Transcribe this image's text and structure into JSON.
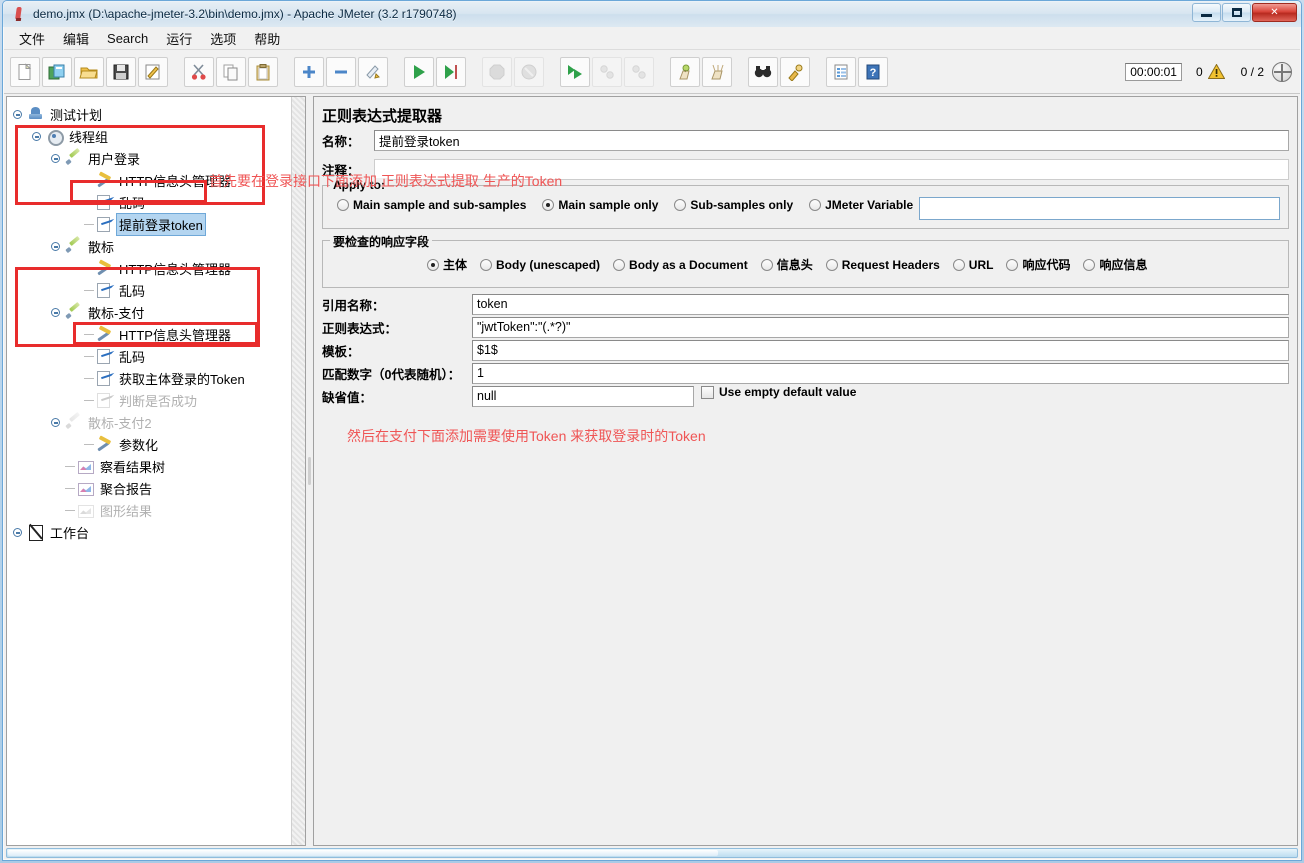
{
  "window": {
    "title": "demo.jmx (D:\\apache-jmeter-3.2\\bin\\demo.jmx) - Apache JMeter (3.2 r1790748)",
    "minimize_label": "",
    "maximize_label": "",
    "close_label": "✕"
  },
  "menubar": {
    "items": [
      {
        "label": "文件",
        "name": "menu-file"
      },
      {
        "label": "编辑",
        "name": "menu-edit"
      },
      {
        "label": "Search",
        "name": "menu-search"
      },
      {
        "label": "运行",
        "name": "menu-run"
      },
      {
        "label": "选项",
        "name": "menu-options"
      },
      {
        "label": "帮助",
        "name": "menu-help"
      }
    ]
  },
  "toolbar": {
    "buttons": [
      {
        "name": "new-icon",
        "title": "新建",
        "disabled": false
      },
      {
        "name": "templates-icon",
        "title": "模板",
        "disabled": false
      },
      {
        "name": "open-icon",
        "title": "打开",
        "disabled": false
      },
      {
        "name": "save-icon",
        "title": "保存",
        "disabled": false
      },
      {
        "name": "save-as-icon",
        "title": "另存为",
        "disabled": false
      },
      {
        "name": "cut-icon",
        "title": "剪切",
        "disabled": false
      },
      {
        "name": "copy-icon",
        "title": "复制",
        "disabled": false
      },
      {
        "name": "paste-icon",
        "title": "粘贴",
        "disabled": false
      },
      {
        "name": "expand-all-icon",
        "title": "展开全部",
        "disabled": false
      },
      {
        "name": "collapse-all-icon",
        "title": "收起全部",
        "disabled": false
      },
      {
        "name": "toggle-icon",
        "title": "切换",
        "disabled": false
      },
      {
        "name": "start-icon",
        "title": "启动",
        "disabled": false
      },
      {
        "name": "start-no-pause-icon",
        "title": "无暂停启动",
        "disabled": false
      },
      {
        "name": "stop-icon",
        "title": "停止",
        "disabled": true
      },
      {
        "name": "shutdown-icon",
        "title": "关闭",
        "disabled": true
      },
      {
        "name": "remote-start-all-icon",
        "title": "远程全部启动",
        "disabled": false
      },
      {
        "name": "remote-stop-all-icon",
        "title": "远程全部停止",
        "disabled": true
      },
      {
        "name": "remote-shutdown-all-icon",
        "title": "远程全部关闭",
        "disabled": true
      },
      {
        "name": "clear-icon",
        "title": "清除",
        "disabled": false
      },
      {
        "name": "clear-all-icon",
        "title": "清除全部",
        "disabled": false
      },
      {
        "name": "search-icon",
        "title": "查找",
        "disabled": false
      },
      {
        "name": "reset-search-icon",
        "title": "重置查找",
        "disabled": false
      },
      {
        "name": "function-helper-icon",
        "title": "函数助手对话框",
        "disabled": false
      },
      {
        "name": "help-icon",
        "title": "帮助",
        "disabled": false
      }
    ],
    "status": {
      "elapsed_time": "00:00:01",
      "warning_count": "0",
      "thread_count": "0 / 2"
    }
  },
  "tree": {
    "nodes": [
      {
        "label": "测试计划",
        "indent": 0,
        "icon": "test-plan-icon",
        "handle": true,
        "tick": false,
        "selected": false,
        "disabled": false,
        "name": "tree-node-test-plan"
      },
      {
        "label": "线程组",
        "indent": 1,
        "icon": "thread-group-icon",
        "handle": true,
        "tick": false,
        "selected": false,
        "disabled": false,
        "name": "tree-node-thread-group"
      },
      {
        "label": "用户登录",
        "indent": 2,
        "icon": "sampler-icon",
        "handle": true,
        "tick": false,
        "selected": false,
        "disabled": false,
        "name": "tree-node-user-login"
      },
      {
        "label": "HTTP信息头管理器",
        "indent": 3,
        "icon": "header-manager-icon",
        "handle": false,
        "tick": true,
        "selected": false,
        "disabled": false,
        "name": "tree-node-header-manager-1"
      },
      {
        "label": "乱码",
        "indent": 3,
        "icon": "regex-extractor-icon",
        "handle": false,
        "tick": true,
        "selected": false,
        "disabled": false,
        "name": "tree-node-luanma-1"
      },
      {
        "label": "提前登录token",
        "indent": 3,
        "icon": "regex-extractor-icon",
        "handle": false,
        "tick": true,
        "selected": true,
        "disabled": false,
        "name": "tree-node-login-token"
      },
      {
        "label": "散标",
        "indent": 2,
        "icon": "sampler-icon",
        "handle": true,
        "tick": false,
        "selected": false,
        "disabled": false,
        "name": "tree-node-sanbiao"
      },
      {
        "label": "HTTP信息头管理器",
        "indent": 3,
        "icon": "header-manager-icon",
        "handle": false,
        "tick": true,
        "selected": false,
        "disabled": false,
        "name": "tree-node-header-manager-2"
      },
      {
        "label": "乱码",
        "indent": 3,
        "icon": "regex-extractor-icon",
        "handle": false,
        "tick": true,
        "selected": false,
        "disabled": false,
        "name": "tree-node-luanma-2"
      },
      {
        "label": "散标-支付",
        "indent": 2,
        "icon": "sampler-icon",
        "handle": true,
        "tick": false,
        "selected": false,
        "disabled": false,
        "name": "tree-node-sanbiao-pay"
      },
      {
        "label": "HTTP信息头管理器",
        "indent": 3,
        "icon": "header-manager-icon",
        "handle": false,
        "tick": true,
        "selected": false,
        "disabled": false,
        "name": "tree-node-header-manager-3"
      },
      {
        "label": "乱码",
        "indent": 3,
        "icon": "regex-extractor-icon",
        "handle": false,
        "tick": true,
        "selected": false,
        "disabled": false,
        "name": "tree-node-luanma-3"
      },
      {
        "label": "获取主体登录的Token",
        "indent": 3,
        "icon": "regex-extractor-icon",
        "handle": false,
        "tick": true,
        "selected": false,
        "disabled": false,
        "name": "tree-node-get-token"
      },
      {
        "label": "判断是否成功",
        "indent": 3,
        "icon": "assertion-icon",
        "handle": false,
        "tick": true,
        "selected": false,
        "disabled": true,
        "name": "tree-node-assertion"
      },
      {
        "label": "散标-支付2",
        "indent": 2,
        "icon": "sampler-icon",
        "handle": true,
        "tick": false,
        "selected": false,
        "disabled": true,
        "name": "tree-node-sanbiao-pay2"
      },
      {
        "label": "参数化",
        "indent": 3,
        "icon": "header-manager-icon",
        "handle": false,
        "tick": true,
        "selected": false,
        "disabled": false,
        "name": "tree-node-params"
      },
      {
        "label": "察看结果树",
        "indent": 2,
        "icon": "listener-icon",
        "handle": false,
        "tick": true,
        "selected": false,
        "disabled": false,
        "name": "tree-node-view-results-tree"
      },
      {
        "label": "聚合报告",
        "indent": 2,
        "icon": "listener-icon",
        "handle": false,
        "tick": true,
        "selected": false,
        "disabled": false,
        "name": "tree-node-aggregate-report"
      },
      {
        "label": "图形结果",
        "indent": 2,
        "icon": "listener-icon",
        "handle": false,
        "tick": true,
        "selected": false,
        "disabled": true,
        "name": "tree-node-graph-results"
      },
      {
        "label": "工作台",
        "indent": 0,
        "icon": "workbench-icon",
        "handle": true,
        "tick": false,
        "selected": false,
        "disabled": false,
        "name": "tree-node-workbench"
      }
    ]
  },
  "annotations": [
    {
      "text": "首先要在登录接口下面添加 正则表达式提取 生产的Token",
      "name": "annotation-login-token"
    },
    {
      "text": "然后在支付下面添加需要使用Token 来获取登录时的Token",
      "name": "annotation-pay-token"
    }
  ],
  "panel": {
    "title": "正则表达式提取器",
    "name_label": "名称：",
    "name_value": "提前登录token",
    "comment_label": "注释：",
    "comment_value": "",
    "apply_to": {
      "legend": "Apply to:",
      "options": [
        {
          "label": "Main sample and sub-samples",
          "selected": false,
          "name": "radio-main-and-sub"
        },
        {
          "label": "Main sample only",
          "selected": true,
          "name": "radio-main-only"
        },
        {
          "label": "Sub-samples only",
          "selected": false,
          "name": "radio-sub-only"
        },
        {
          "label": "JMeter Variable",
          "selected": false,
          "name": "radio-jmeter-variable"
        }
      ],
      "variable_value": ""
    },
    "response_field": {
      "legend": "要检查的响应字段",
      "options": [
        {
          "label": "主体",
          "selected": true,
          "name": "radio-body"
        },
        {
          "label": "Body (unescaped)",
          "selected": false,
          "name": "radio-body-unescaped"
        },
        {
          "label": "Body as a Document",
          "selected": false,
          "name": "radio-body-as-document"
        },
        {
          "label": "信息头",
          "selected": false,
          "name": "radio-headers"
        },
        {
          "label": "Request Headers",
          "selected": false,
          "name": "radio-request-headers"
        },
        {
          "label": "URL",
          "selected": false,
          "name": "radio-url"
        },
        {
          "label": "响应代码",
          "selected": false,
          "name": "radio-response-code"
        },
        {
          "label": "响应信息",
          "selected": false,
          "name": "radio-response-message"
        }
      ]
    },
    "fields": [
      {
        "label": "引用名称：",
        "value": "token",
        "name": "reference-name"
      },
      {
        "label": "正则表达式：",
        "value": "\"jwtToken\":\"(.*?)\"",
        "name": "regular-expression"
      },
      {
        "label": "模板：",
        "value": "$1$",
        "name": "template"
      },
      {
        "label": "匹配数字（0代表随机）：",
        "value": "1",
        "name": "match-no"
      },
      {
        "label": "缺省值：",
        "value": "null",
        "name": "default-value"
      }
    ],
    "use_empty_default": {
      "label": "Use empty default value",
      "checked": false
    }
  },
  "colors": {
    "annotation_red": "#ef5555",
    "box_red": "#e82c2c",
    "selection_blue": "#b4d5f0",
    "panel_bg": "#f0f0f0"
  }
}
